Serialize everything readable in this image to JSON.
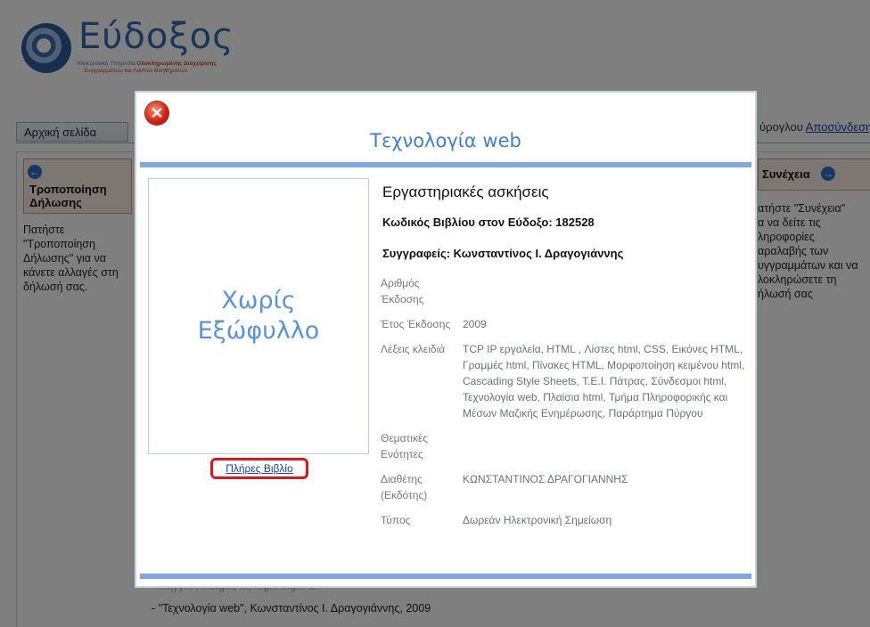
{
  "site": {
    "logo_name": "Εύδοξος",
    "logo_subtitle_1a": "Ηλεκτρονική Υπηρεσία",
    "logo_subtitle_1b": "Ολοκληρωμένης Διαχείρισης",
    "logo_subtitle_2": "Συγγραμμάτων και Λοιπών Βοηθημάτων",
    "user_text_fragment": "ύρογλου",
    "logout_link": "Αποσύνδεση"
  },
  "nav": {
    "home_tab": "Αρχική σελίδα"
  },
  "left_panel": {
    "title": "Τροποποίηση Δήλωσης",
    "body": "Πατήστε \"Τροποποίηση Δήλωσης\" για να κάνετε αλλαγές στη δήλωσή σας."
  },
  "right_panel": {
    "title": "Συνέχεια",
    "lines": [
      "ατήστε \"Συνέχεια\"",
      "α να δείτε τις",
      "ληροφορίες",
      "αραλαβής των",
      "υγγραμμάτων και να",
      "λοκληρώσετε τη",
      "ήλωσή σας"
    ]
  },
  "background_list": {
    "line_partial": "- ...ηγγ... , ...ing..., ..., ...g... ...g... ...",
    "line_2": "- \"Τεχνολογία web\", Κωνσταντίνος Ι. Δραγογιάννης, 2009"
  },
  "dialog": {
    "title": "Τεχνολογία web",
    "cover_placeholder": "Χωρίς\nΕξώφυλλο",
    "full_book_link": "Πλήρες Βιβλίο",
    "book_name": "Εργαστηριακές ασκήσεις",
    "code_line": "Κωδικός Βιβλίου στον Εύδοξο: 182528",
    "authors_line": "Συγγραφείς: Κωνσταντίνος Ι. Δραγογιάννης",
    "details": [
      {
        "label": "Αριθμός Έκδοσης",
        "value": ""
      },
      {
        "label": "Έτος Έκδοσης",
        "value": "2009"
      },
      {
        "label": "Λέξεις κλειδιά",
        "value": "TCP IP εργαλεία, HTML , Λίστες html, CSS, Εικόνες HTML, Γραμμές html, Πίνακες HTML, Μορφοποίηση κειμένου html, Cascading Style Sheets, Τ.Ε.Ι. Πάτρας, Σύνδεσμοι html, Τεχνολογία web, Πλαίσια html, Τμήμα Πληροφορικής και Μέσων Μαζικής Ενημέρωσης, Παράρτημα Πύργου"
      },
      {
        "label": "Θεματικές Ενότητες",
        "value": ""
      },
      {
        "label": "Διαθέτης (Εκδότης)",
        "value": "ΚΩΝΣΤΑΝΤΙΝΟΣ ΔΡΑΓΟΓΙΑΝΝΗΣ"
      },
      {
        "label": "Τύπος",
        "value": "Δωρεάν Ηλεκτρονική Σημείωση"
      }
    ]
  },
  "colors": {
    "overlay": "#808080",
    "accent": "#3f7fcc",
    "dialog_rule": "#7fa8dc",
    "highlight": "#e0161c"
  }
}
